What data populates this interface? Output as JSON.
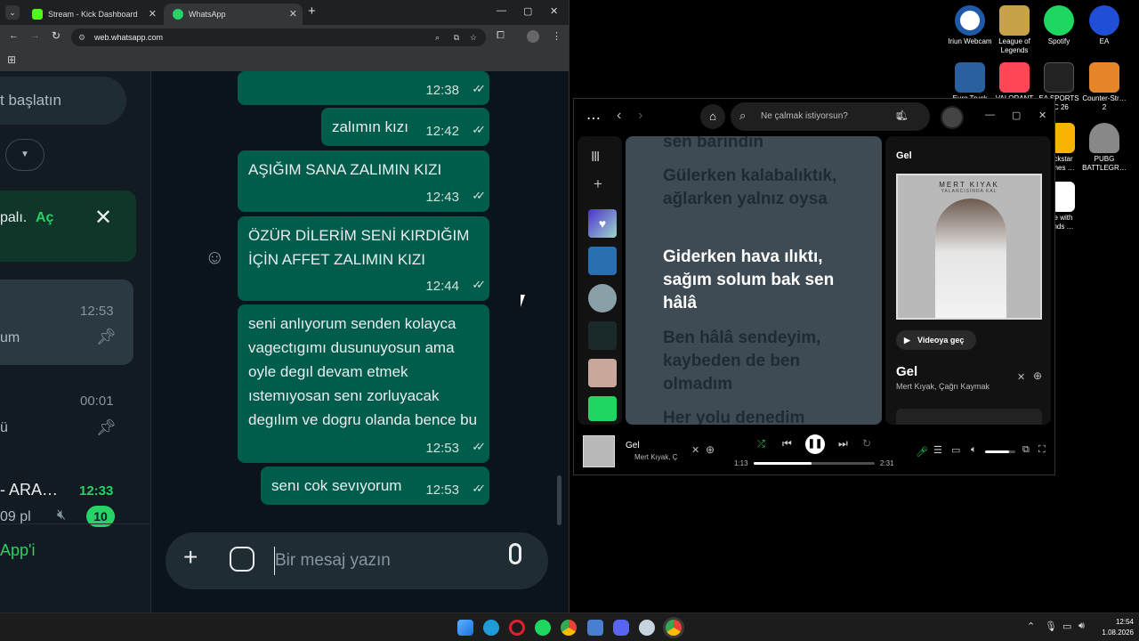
{
  "chrome": {
    "tabs": [
      {
        "title": "Stream - Kick Dashboard",
        "active": false
      },
      {
        "title": "WhatsApp",
        "active": true
      }
    ],
    "new_tab": "+",
    "url": "web.whatsapp.com"
  },
  "whatsapp": {
    "left": {
      "start_chat": "t başlatın",
      "banner_text": "palı.",
      "banner_link": "Aç",
      "chats": [
        {
          "title": "",
          "subtitle": "um",
          "time": "12:53"
        },
        {
          "title": "",
          "subtitle": "ü",
          "time": "00:01"
        },
        {
          "title": "- ARA…",
          "subtitle": "09 pl",
          "time": "12:33",
          "unread": "10"
        }
      ],
      "footer": "App'i"
    },
    "messages": [
      {
        "text": "",
        "time": "12:38"
      },
      {
        "text": "zalımın kızı",
        "time": "12:42"
      },
      {
        "text": "AŞIĞIM SANA ZALIMIN KIZI",
        "time": "12:43"
      },
      {
        "text": "ÖZÜR DİLERİM SENİ KIRDIĞIM İÇİN AFFET ZALIMIN KIZI",
        "time": "12:44"
      },
      {
        "text": "seni anlıyorum senden kolayca vagectıgımı dusunuyosun ama oyle degıl devam etmek ıstemıyosan senı zorluyacak degılım ve dogru olanda bence bu",
        "time": "12:53"
      },
      {
        "text": "senı cok sevıyorum",
        "time": "12:53"
      }
    ],
    "compose_placeholder": "Bir mesaj yazın"
  },
  "spotify": {
    "search_placeholder": "Ne çalmak istiyorsun?",
    "lyrics": [
      {
        "text": "sen barındın",
        "active": false
      },
      {
        "text": "Gülerken kalabalıktık, ağlarken yalnız oysa",
        "active": false
      },
      {
        "text": "Giderken hava ılıktı, sağım solum bak sen hâlâ",
        "active": true
      },
      {
        "text": "Ben hâlâ sendeyim, kaybeden de ben olmadım",
        "active": false
      },
      {
        "text": "Her yolu denedim",
        "active": false
      }
    ],
    "panel": {
      "heading": "Gel",
      "cover_artist": "MERT KIYAK",
      "cover_subtitle": "YALANCISINDA KAL",
      "video_button": "Videoya geç",
      "track_title": "Gel",
      "track_artists": "Mert Kıyak, Çağrı Kaymak"
    },
    "player": {
      "title": "Gel",
      "artists": "Mert Kıyak, Ç",
      "elapsed": "1:13",
      "total": "2:31",
      "progress": 0.48,
      "volume": 0.8
    }
  },
  "desktop_icons": [
    {
      "label": "Iriun Webcam",
      "color": "#1e5aa8"
    },
    {
      "label": "League of Legends",
      "color": "#c8a248"
    },
    {
      "label": "Spotify",
      "color": "#1ed760"
    },
    {
      "label": "EA",
      "color": "#1f4fd6"
    },
    {
      "label": "Euro Truck",
      "color": "#2a5fa0"
    },
    {
      "label": "VALORANT",
      "color": "#ff4655"
    },
    {
      "label": "EA SPORTS FC 26",
      "color": "#222222"
    },
    {
      "label": "Counter-Str… 2",
      "color": "#e7852a"
    },
    {
      "label": "ckstar mes …",
      "color": "#f8b400"
    },
    {
      "label": "PUBG BATTLEGR…",
      "color": "#888888"
    },
    {
      "label": "e with nds …",
      "color": "#ffffff"
    }
  ],
  "taskbar": {
    "time": "12:54",
    "date": "1.08.2026"
  }
}
